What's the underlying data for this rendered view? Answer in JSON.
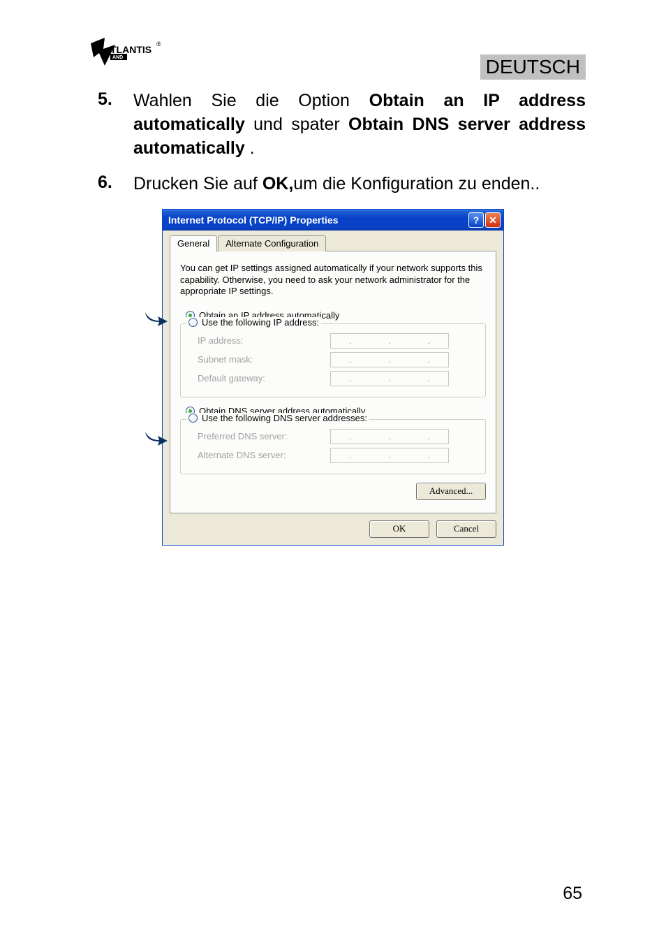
{
  "header": {
    "logo_text_top": "TLANTIS",
    "logo_text_sub": "AND",
    "logo_reg": "®",
    "language": "DEUTSCH"
  },
  "instructions": {
    "item5_num": "5.",
    "item5_p1": "Wahlen Sie die Option  ",
    "item5_b1": "Obtain an IP address automatically",
    "item5_p2": " und spater ",
    "item5_b2": "Obtain DNS server address automatically ",
    "item5_p3": ".",
    "item6_num": "6.",
    "item6_p1": "Drucken Sie auf ",
    "item6_b1": "OK,",
    "item6_p2": "um die Konfiguration zu enden.."
  },
  "dialog": {
    "title": "Internet Protocol (TCP/IP) Properties",
    "help_glyph": "?",
    "close_glyph": "✕",
    "tabs": {
      "general": "General",
      "alternate": "Alternate Configuration"
    },
    "description": "You can get IP settings assigned automatically if your network supports this capability. Otherwise, you need to ask your network administrator for the appropriate IP settings.",
    "radio_obtain_ip": "Obtain an IP address automatically",
    "radio_use_ip": "Use the following IP address:",
    "fields": {
      "ip": "IP address:",
      "subnet": "Subnet mask:",
      "gateway": "Default gateway:"
    },
    "radio_obtain_dns": "Obtain DNS server address automatically",
    "radio_use_dns": "Use the following DNS server addresses:",
    "dns_fields": {
      "preferred": "Preferred DNS server:",
      "alternate": "Alternate DNS server:"
    },
    "ip_dot": ".",
    "advanced": "Advanced...",
    "ok": "OK",
    "cancel": "Cancel"
  },
  "page_number": "65"
}
